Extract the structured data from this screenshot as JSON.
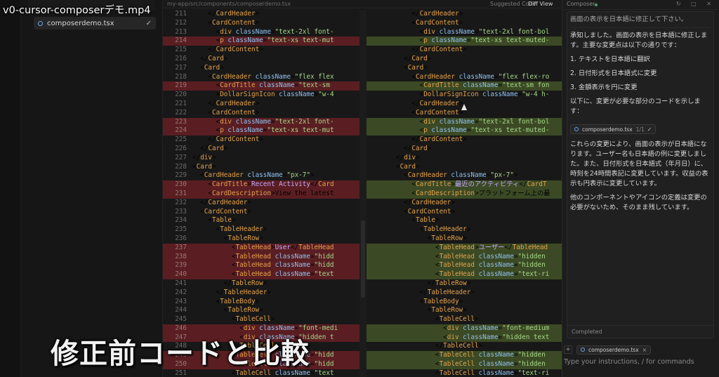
{
  "video_title": "v0-cursor-composerデモ.mp4",
  "sidebar": {
    "file_tab": "composerdemo.tsx",
    "check": "✓"
  },
  "editor_header": {
    "path": "my-app/src/components/composerdemo.tsx",
    "suggested": "Suggested Code",
    "diff_view": "Diff View"
  },
  "diff": {
    "left": [
      {
        "n": "211",
        "t": "normal",
        "code": "    </CardHeader>"
      },
      {
        "n": "212",
        "t": "normal",
        "code": "    <CardContent>"
      },
      {
        "n": "213",
        "t": "normal",
        "code": "      <div className=\"text-2xl font-"
      },
      {
        "n": "214",
        "t": "del",
        "code": "      <p className=\"text-xs text-mut"
      },
      {
        "n": "215",
        "t": "normal",
        "code": "    </CardContent>"
      },
      {
        "n": "216",
        "t": "normal",
        "code": "  </Card>"
      },
      {
        "n": "217",
        "t": "normal",
        "code": "  <Card>"
      },
      {
        "n": "218",
        "t": "normal",
        "code": "    <CardHeader className=\"flex flex"
      },
      {
        "n": "219",
        "t": "del",
        "code": "      <CardTitle className=\"text-sm "
      },
      {
        "n": "220",
        "t": "normal",
        "code": "      <DollarSignIcon className=\"w-4"
      },
      {
        "n": "221",
        "t": "normal",
        "code": "    </CardHeader>"
      },
      {
        "n": "222",
        "t": "normal",
        "code": "    <CardContent>"
      },
      {
        "n": "223",
        "t": "del",
        "code": "      <div className=\"text-2xl font-"
      },
      {
        "n": "224",
        "t": "del",
        "code": "      <p className=\"text-xs text-mut"
      },
      {
        "n": "225",
        "t": "normal",
        "code": "    </CardContent>"
      },
      {
        "n": "226",
        "t": "normal",
        "code": "  </Card>"
      },
      {
        "n": "227",
        "t": "normal",
        "code": "</div>"
      },
      {
        "n": "228",
        "t": "normal",
        "code": "<Card>"
      },
      {
        "n": "229",
        "t": "normal",
        "code": "  <CardHeader className=\"px-7\">"
      },
      {
        "n": "230",
        "t": "del",
        "code": "    <CardTitle>Recent Activity</Card"
      },
      {
        "n": "231",
        "t": "del",
        "code": "    <CardDescription>View the latest"
      },
      {
        "n": "232",
        "t": "normal",
        "code": "  </CardHeader>"
      },
      {
        "n": "233",
        "t": "normal",
        "code": "  <CardContent>"
      },
      {
        "n": "234",
        "t": "normal",
        "code": "    <Table>"
      },
      {
        "n": "235",
        "t": "normal",
        "code": "      <TableHeader>"
      },
      {
        "n": "236",
        "t": "normal",
        "code": "        <TableRow>"
      },
      {
        "n": "237",
        "t": "del",
        "code": "          <TableHead>User</TableHead"
      },
      {
        "n": "238",
        "t": "del",
        "code": "          <TableHead className=\"hidd"
      },
      {
        "n": "239",
        "t": "del",
        "code": "          <TableHead className=\"hidd"
      },
      {
        "n": "240",
        "t": "del",
        "code": "          <TableHead className=\"text"
      },
      {
        "n": "241",
        "t": "normal",
        "code": "        </TableRow>"
      },
      {
        "n": "242",
        "t": "normal",
        "code": "      </TableHeader>"
      },
      {
        "n": "243",
        "t": "normal",
        "code": "      <TableBody>"
      },
      {
        "n": "244",
        "t": "normal",
        "code": "        <TableRow>"
      },
      {
        "n": "245",
        "t": "normal",
        "code": "          <TableCell>"
      },
      {
        "n": "246",
        "t": "del",
        "code": "            <div className=\"font-medi"
      },
      {
        "n": "247",
        "t": "del",
        "code": "            <div className=\"hidden t"
      },
      {
        "n": "248",
        "t": "normal",
        "code": "          </TableCell>"
      },
      {
        "n": "249",
        "t": "del",
        "code": "          <TableCell className=\"hidd"
      },
      {
        "n": "250",
        "t": "del",
        "code": "          <TableCell className=\"hidd"
      },
      {
        "n": "251",
        "t": "normal",
        "code": "          <TableCell className=\"text"
      }
    ],
    "right": [
      {
        "n": "",
        "t": "normal",
        "code": "    </CardHeader>"
      },
      {
        "n": "",
        "t": "normal",
        "code": "    <CardContent>"
      },
      {
        "n": "",
        "t": "normal",
        "code": "      <div className=\"text-2xl font-bol"
      },
      {
        "n": "",
        "t": "add",
        "code": "      <p className=\"text-xs text-muted-"
      },
      {
        "n": "",
        "t": "normal",
        "code": "    </CardContent>"
      },
      {
        "n": "",
        "t": "normal",
        "code": "  </Card>"
      },
      {
        "n": "",
        "t": "normal",
        "code": "  <Card>"
      },
      {
        "n": "",
        "t": "normal",
        "code": "    <CardHeader className=\"flex flex-ro"
      },
      {
        "n": "",
        "t": "add",
        "code": "      <CardTitle className=\"text-sm fon"
      },
      {
        "n": "",
        "t": "normal",
        "code": "      <DollarSignIcon className=\"w-4 h-"
      },
      {
        "n": "",
        "t": "normal",
        "code": "    </CardHeader>"
      },
      {
        "n": "",
        "t": "normal",
        "code": "    <CardContent>"
      },
      {
        "n": "",
        "t": "add",
        "code": "      <div className=\"text-2xl font-bol"
      },
      {
        "n": "",
        "t": "add",
        "code": "      <p className=\"text-xs text-muted-"
      },
      {
        "n": "",
        "t": "normal",
        "code": "    </CardContent>"
      },
      {
        "n": "",
        "t": "normal",
        "code": "  </Card>"
      },
      {
        "n": "",
        "t": "normal",
        "code": "</div>"
      },
      {
        "n": "",
        "t": "normal",
        "code": "<Card>"
      },
      {
        "n": "",
        "t": "normal",
        "code": "  <CardHeader className=\"px-7\">"
      },
      {
        "n": "",
        "t": "add",
        "code": "    <CardTitle>最近のアクティビティ</CardT"
      },
      {
        "n": "",
        "t": "add",
        "code": "    <CardDescription>プラットフォーム上の最"
      },
      {
        "n": "",
        "t": "normal",
        "code": "  </CardHeader>"
      },
      {
        "n": "",
        "t": "normal",
        "code": "  <CardContent>"
      },
      {
        "n": "",
        "t": "normal",
        "code": "    <Table>"
      },
      {
        "n": "",
        "t": "normal",
        "code": "      <TableHeader>"
      },
      {
        "n": "",
        "t": "normal",
        "code": "        <TableRow>"
      },
      {
        "n": "",
        "t": "add",
        "code": "          <TableHead>ユーザー</TableHead"
      },
      {
        "n": "",
        "t": "add",
        "code": "          <TableHead className=\"hidden"
      },
      {
        "n": "",
        "t": "add",
        "code": "          <TableHead className=\"hidden"
      },
      {
        "n": "",
        "t": "add",
        "code": "          <TableHead className=\"text-ri"
      },
      {
        "n": "",
        "t": "normal",
        "code": "        </TableRow>"
      },
      {
        "n": "",
        "t": "normal",
        "code": "      </TableHeader>"
      },
      {
        "n": "",
        "t": "normal",
        "code": "      <TableBody>"
      },
      {
        "n": "",
        "t": "normal",
        "code": "        <TableRow>"
      },
      {
        "n": "",
        "t": "normal",
        "code": "          <TableCell>"
      },
      {
        "n": "",
        "t": "add",
        "code": "            <div className=\"font-medium"
      },
      {
        "n": "",
        "t": "add",
        "code": "            <div className=\"hidden text"
      },
      {
        "n": "",
        "t": "normal",
        "code": "          </TableCell>"
      },
      {
        "n": "",
        "t": "add",
        "code": "          <TableCell className=\"hidden"
      },
      {
        "n": "",
        "t": "add",
        "code": "          <TableCell className=\"hidden"
      },
      {
        "n": "",
        "t": "normal",
        "code": "          <TableCell className=\"text-ri"
      }
    ]
  },
  "composer": {
    "title": "Composer",
    "icons": "↻ □ ✕",
    "user_message": "画面の表示を日本語に修正して下さい。",
    "intro": "承知しました。画面の表示を日本語に修正します。主要な変更点は以下の通りです：",
    "steps": [
      "1. テキストを日本語に翻訳",
      "2. 日付形式を日本語式に変更",
      "3. 金額表示を円に変更"
    ],
    "code_intro": "以下に、変更が必要な部分のコードを示します：",
    "ref_file": "composerdemo.tsx",
    "ref_count": "1/1",
    "ref_check": "✓",
    "para1": "これらの変更により、画面の表示が日本語になります。ユーザー名も日本語の例に変更しました。また、日付形式を日本語式（年月日）に、時刻を24時間表記に変更しています。収益の表示も円表示に変更しています。",
    "para2": "他のコンポーネントやアイコンの定義は変更の必要がないため、そのまま残しています。",
    "completed": "Completed",
    "ctx_plus": "+",
    "ctx_file": "composerdemo.tsx",
    "ctx_close": "×",
    "input_placeholder": "Type your instructions, / for commands"
  },
  "caption": "修正前コードと比較",
  "colors": {
    "deleted_line": "#5a1e22",
    "added_line": "#3b4a24",
    "tag": "#e5a24a",
    "attribute": "#8fc0f0",
    "string": "#a8d98a"
  }
}
